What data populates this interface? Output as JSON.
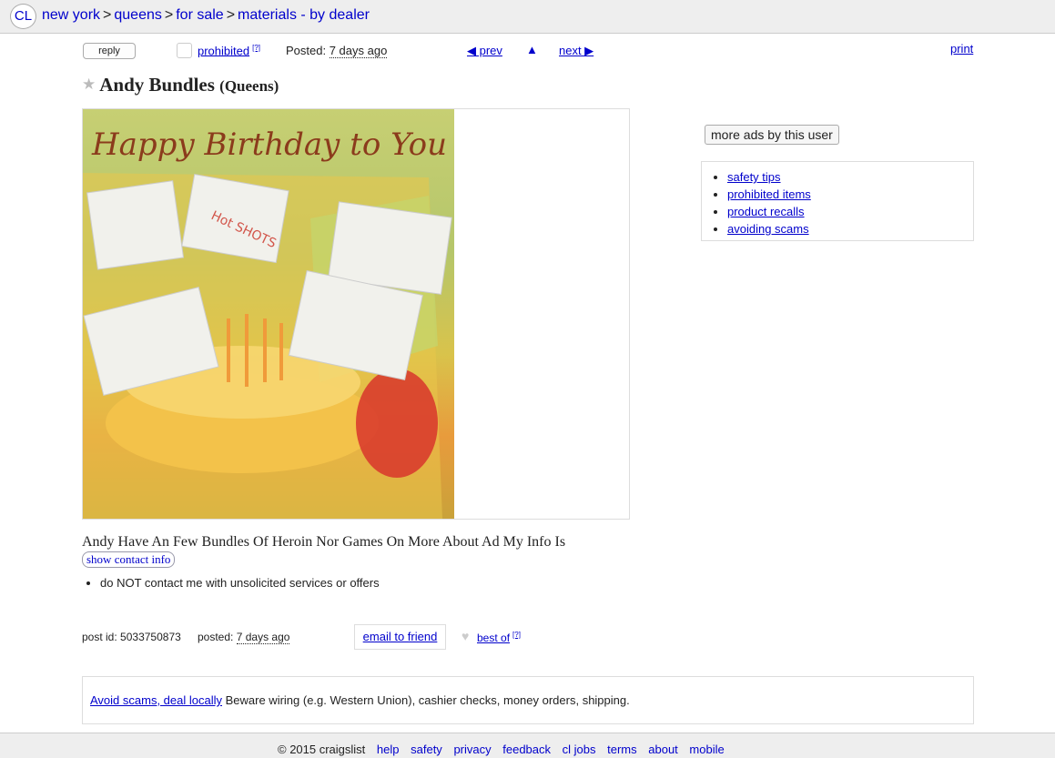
{
  "header": {
    "logo": "CL",
    "breadcrumbs": [
      "new york",
      "queens",
      "for sale",
      "materials - by dealer"
    ],
    "separator": ">"
  },
  "toolbar": {
    "reply": "reply",
    "prohibited": "prohibited",
    "prohibited_help": "[?]",
    "posted_label": "Posted:",
    "posted_value": "7 days ago",
    "prev": "◀ prev",
    "up": "▲",
    "next": "next ▶",
    "print": "print"
  },
  "post": {
    "title": "Andy Bundles",
    "location": "(Queens)",
    "image_caption": "Happy Birthday to You",
    "packet_text": "Hot SHOTS",
    "body": "Andy Have An Few Bundles Of Heroin Nor Games On More About Ad My Info Is",
    "show_contact": "show contact info",
    "notices": [
      "do NOT contact me with unsolicited services or offers"
    ],
    "post_id_label": "post id:",
    "post_id": "5033750873",
    "posted_label": "posted:",
    "posted_value": "7 days ago",
    "email_friend": "email to friend",
    "best_of": "best of",
    "best_of_help": "[?]"
  },
  "sidebar": {
    "more_ads": "more ads by this user",
    "links": [
      "safety tips",
      "prohibited items",
      "product recalls",
      "avoiding scams"
    ]
  },
  "scam_notice": {
    "link": "Avoid scams, deal locally",
    "text": " Beware wiring (e.g. Western Union), cashier checks, money orders, shipping."
  },
  "footer": {
    "copyright": "© 2015 craigslist",
    "links": [
      "help",
      "safety",
      "privacy",
      "feedback",
      "cl jobs",
      "terms",
      "about",
      "mobile"
    ]
  },
  "colors": {
    "link": "#0000cc",
    "bar_bg": "#eeeeee"
  },
  "icons": [
    "star-icon",
    "up-arrow-icon",
    "heart-icon"
  ]
}
